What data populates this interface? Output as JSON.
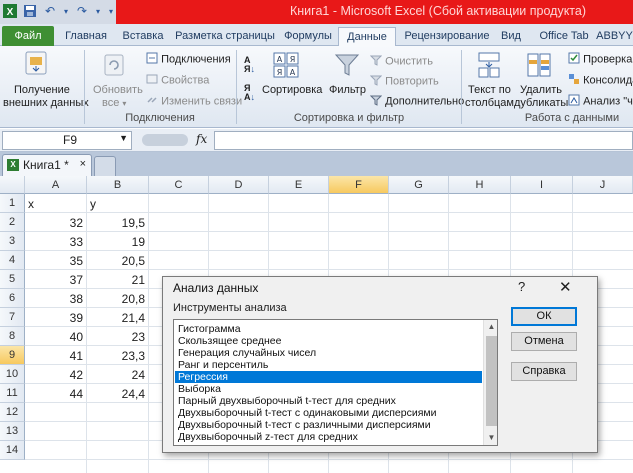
{
  "window": {
    "title": "Книга1  -  Microsoft Excel (Сбой активации продукта)"
  },
  "ribbon_tabs": [
    "Файл",
    "Главная",
    "Вставка",
    "Разметка страницы",
    "Формулы",
    "Данные",
    "Рецензирование",
    "Вид",
    "Office Tab",
    "ABBYY"
  ],
  "ribbon": {
    "get_external_1": "Получение",
    "get_external_2": "внешних данных",
    "refresh_1": "Обновить",
    "refresh_2": "все",
    "connections": "Подключения",
    "properties": "Свойства",
    "edit_links": "Изменить связи",
    "group_connections": "Подключения",
    "sort": "Сортировка",
    "filter": "Фильтр",
    "clear": "Очистить",
    "reapply": "Повторить",
    "advanced": "Дополнительно",
    "group_sort_filter": "Сортировка и фильтр",
    "text_to_cols_1": "Текст по",
    "text_to_cols_2": "столбцам",
    "remove_dup_1": "Удалить",
    "remove_dup_2": "дубликаты",
    "data_validation": "Проверка д",
    "consolidate": "Консолида",
    "what_if": "Анализ \"что",
    "group_data_tools": "Работа с данными"
  },
  "formula_bar": {
    "name_box": "F9",
    "fx": "fx",
    "value": ""
  },
  "workbook_tab": {
    "label": "Книга1 *",
    "close": "×"
  },
  "grid": {
    "columns": [
      "A",
      "B",
      "C",
      "D",
      "E",
      "F",
      "G",
      "H",
      "I",
      "J"
    ],
    "rows": [
      "1",
      "2",
      "3",
      "4",
      "5",
      "6",
      "7",
      "8",
      "9",
      "10",
      "11",
      "12",
      "13",
      "14"
    ],
    "header_a": "x",
    "header_b": "y",
    "x_values": [
      "32",
      "33",
      "35",
      "37",
      "38",
      "39",
      "40",
      "41",
      "42",
      "44"
    ],
    "y_values": [
      "19,5",
      "19",
      "20,5",
      "21",
      "20,8",
      "21,4",
      "23",
      "23,3",
      "24",
      "24,4"
    ],
    "active_cell": "F9"
  },
  "dialog": {
    "title": "Анализ данных",
    "help": "?",
    "close": "✕",
    "label": "Инструменты анализа",
    "tools": [
      "Гистограмма",
      "Скользящее среднее",
      "Генерация случайных чисел",
      "Ранг и персентиль",
      "Регрессия",
      "Выборка",
      "Парный двухвыборочный t-тест для средних",
      "Двухвыборочный t-тест с одинаковыми дисперсиями",
      "Двухвыборочный t-тест с различными дисперсиями",
      "Двухвыборочный z-тест для средних"
    ],
    "selected_index": 4,
    "ok": "ОК",
    "cancel": "Отмена",
    "help_button": "Справка"
  },
  "colors": {
    "title_red": "#e81818",
    "file_tab": "#3f8f33",
    "selection": "#0078d7"
  }
}
